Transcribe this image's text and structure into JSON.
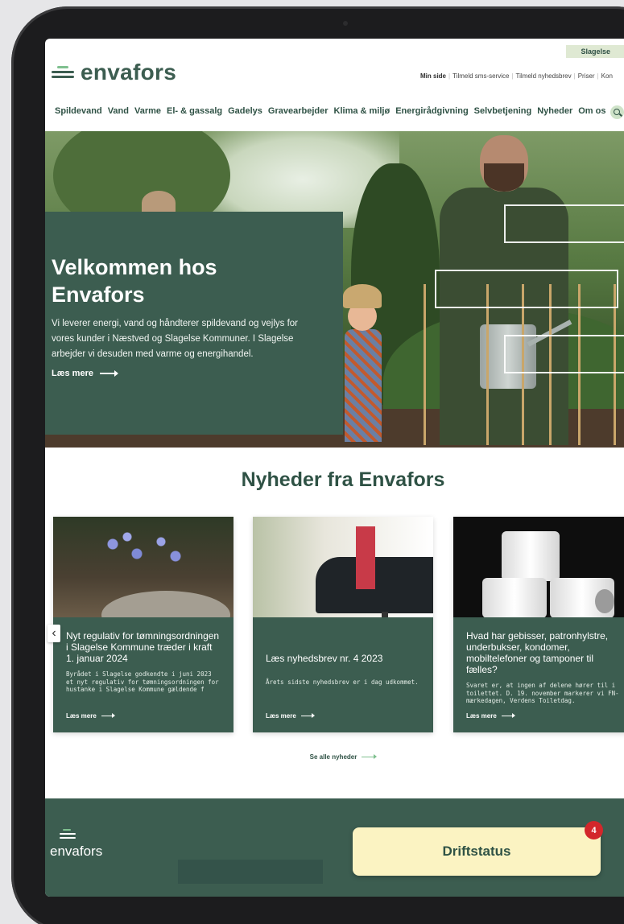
{
  "header": {
    "region": "Slagelse",
    "logo_text": "envafors",
    "utility_links": [
      "Min side",
      "Tilmeld sms-service",
      "Tilmeld nyhedsbrev",
      "Priser",
      "Kon"
    ],
    "nav": [
      "Spildevand",
      "Vand",
      "Varme",
      "El- & gassalg",
      "Gadelys",
      "Gravearbejder",
      "Klima & miljø",
      "Energirådgivning",
      "Selvbetjening",
      "Nyheder",
      "Om os"
    ]
  },
  "hero": {
    "title": "Velkommen hos Envafors",
    "text": "Vi leverer energi, vand og håndterer spildevand og vejlys for vores kunder i Næstved og Slagelse Kommuner. I Slagelse arbejder vi desuden med varme og energihandel.",
    "link": "Læs mere"
  },
  "news": {
    "title": "Nyheder fra Envafors",
    "cards": [
      {
        "title": "Nyt regulativ for tømningsordningen i Slagelse Kommune træder i kraft 1. januar 2024",
        "text": "Byrådet i Slagelse godkendte i juni 2023 et nyt regulativ for tømningsordningen for hustanke i Slagelse Kommune gældende f",
        "link": "Læs mere"
      },
      {
        "title": "Læs nyhedsbrev nr. 4 2023",
        "text": "Årets sidste nyhedsbrev er i dag udkommet.",
        "link": "Læs mere"
      },
      {
        "title": "Hvad har gebisser, patronhylstre, underbukser, kondomer, mobiltelefoner og tamponer til fælles?",
        "text": "Svaret er, at ingen af delene hører til i toilettet. D. 19. november markerer vi FN-mærkedagen, Verdens Toiletdag.",
        "link": "Læs mere"
      }
    ],
    "see_all": "Se alle nyheder"
  },
  "footer": {
    "logo_text": "envafors",
    "driftstatus": "Driftstatus",
    "badge_count": "4"
  },
  "colors": {
    "brand_green": "#3c5d50",
    "accent_light_green": "#7fc08f",
    "drift_yellow": "#fbf3c2",
    "badge_red": "#d3272b"
  }
}
